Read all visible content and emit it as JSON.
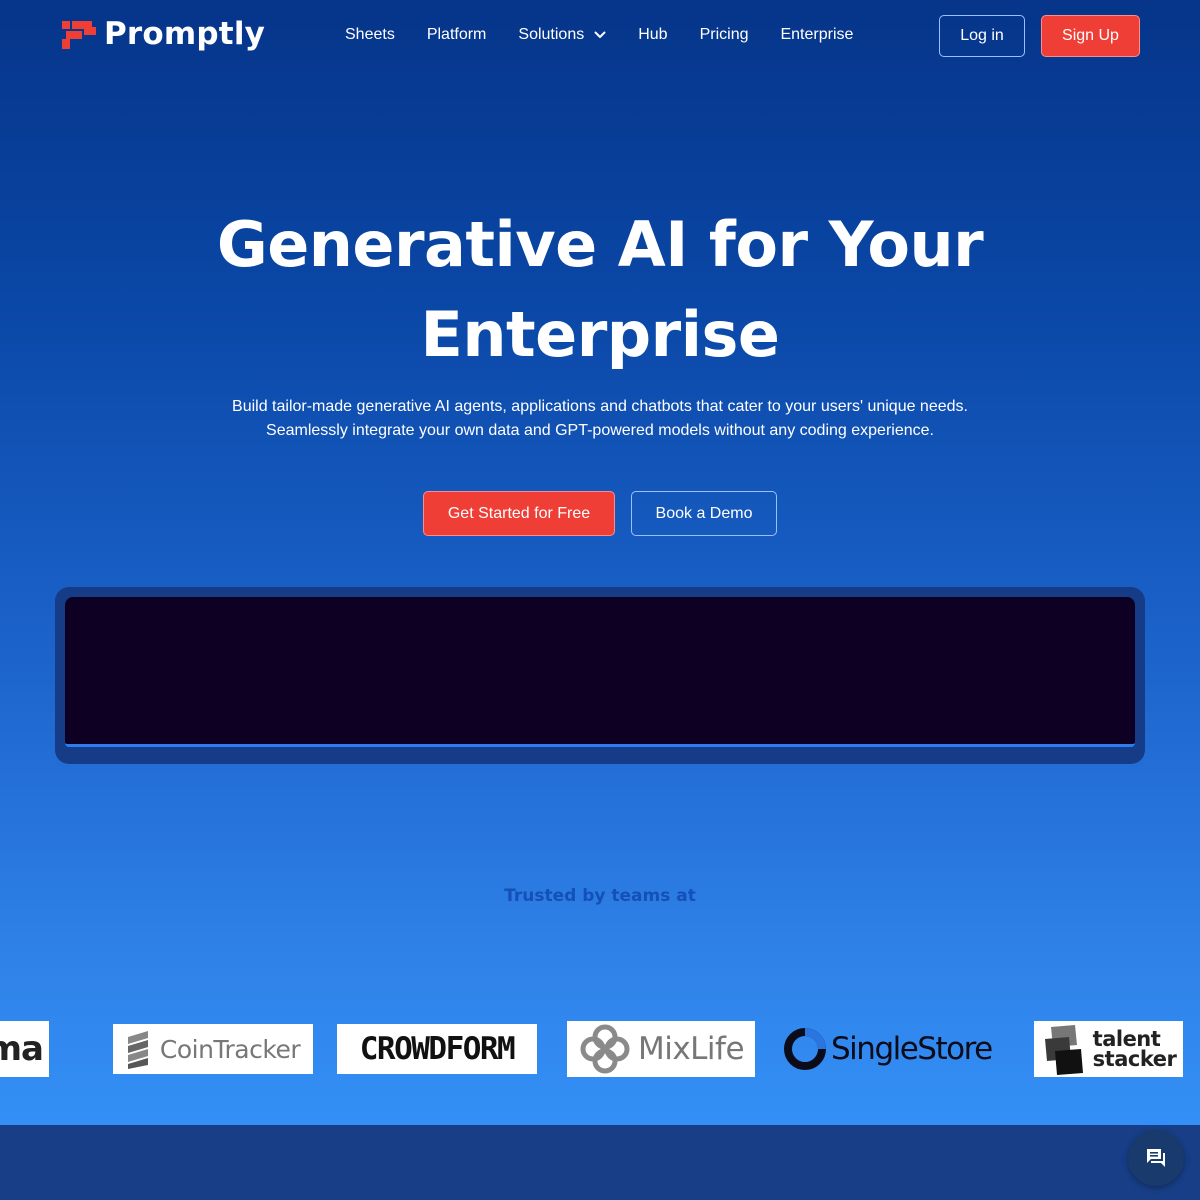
{
  "brand": {
    "name": "Promptly",
    "accent": "#ef3e36"
  },
  "nav": {
    "items": [
      {
        "label": "Sheets"
      },
      {
        "label": "Platform"
      },
      {
        "label": "Solutions",
        "has_dropdown": true
      },
      {
        "label": "Hub"
      },
      {
        "label": "Pricing"
      },
      {
        "label": "Enterprise"
      }
    ],
    "login_label": "Log in",
    "signup_label": "Sign Up"
  },
  "hero": {
    "title_line1": "Generative AI for Your",
    "title_line2": "Enterprise",
    "subtitle_line1": "Build tailor-made generative AI agents, applications and chatbots that cater to your users' unique needs.",
    "subtitle_line2": "Seamlessly integrate your own data and GPT-powered models without any coding experience.",
    "cta_primary": "Get Started for Free",
    "cta_secondary": "Book a Demo"
  },
  "trusted": {
    "heading": "Trusted by teams at",
    "logos": [
      {
        "name": "ma"
      },
      {
        "name": "CoinTracker"
      },
      {
        "name": "CROWDFORM"
      },
      {
        "name": "MixLife"
      },
      {
        "name": "SingleStore"
      },
      {
        "name_line1": "talent",
        "name_line2": "stacker"
      }
    ]
  },
  "chat": {
    "icon": "chat-icon"
  }
}
